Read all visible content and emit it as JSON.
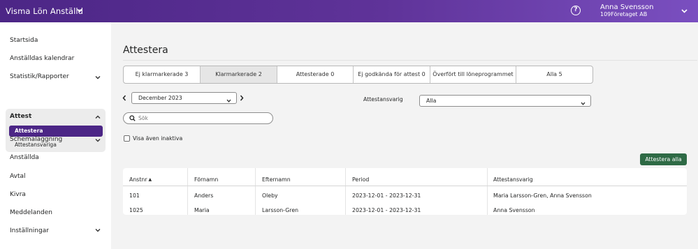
{
  "header": {
    "app_title": "Visma Lön Anställd",
    "user_name": "Anna Svensson",
    "company": "109Företaget AB"
  },
  "sidebar": {
    "items": [
      {
        "label": "Startsida"
      },
      {
        "label": "Anställdas kalendrar"
      },
      {
        "label": "Statistik/Rapporter"
      },
      {
        "label": "Attest"
      },
      {
        "label": "Schemaläggning"
      },
      {
        "label": "Anställda"
      },
      {
        "label": "Avtal"
      },
      {
        "label": "Kivra"
      },
      {
        "label": "Meddelanden"
      },
      {
        "label": "Inställningar"
      }
    ],
    "attest_sub": [
      {
        "label": "Attestera"
      },
      {
        "label": "Attestansvariga"
      }
    ]
  },
  "main": {
    "title": "Attestera",
    "tabs": [
      {
        "label": "Ej klarmarkerade 3"
      },
      {
        "label": "Klarmarkerade 2"
      },
      {
        "label": "Attesterade 0"
      },
      {
        "label": "Ej godkända för attest 0"
      },
      {
        "label": "Överfört till löneprogrammet 0"
      },
      {
        "label": "Alla 5"
      }
    ],
    "month": "December 2023",
    "attestansvarig_label": "Attestansvarig",
    "attestansvarig_value": "Alla",
    "search_placeholder": "Sök",
    "inactive_label": "Visa även inaktiva",
    "attest_all_button": "Attestera alla"
  },
  "table": {
    "columns": [
      "Anstnr",
      "Förnamn",
      "Efternamn",
      "Period",
      "Attestansvarig"
    ],
    "rows": [
      [
        "101",
        "Anders",
        "Oleby",
        "2023-12-01 - 2023-12-31",
        "Maria Larsson-Gren, Anna Svensson"
      ],
      [
        "1025",
        "Maria",
        "Larsson-Gren",
        "2023-12-01 - 2023-12-31",
        "Anna Svensson"
      ]
    ]
  },
  "colors": {
    "header_purple": "#4c2686",
    "active_nav": "#4c2686",
    "primary_button": "#2e6a45"
  }
}
